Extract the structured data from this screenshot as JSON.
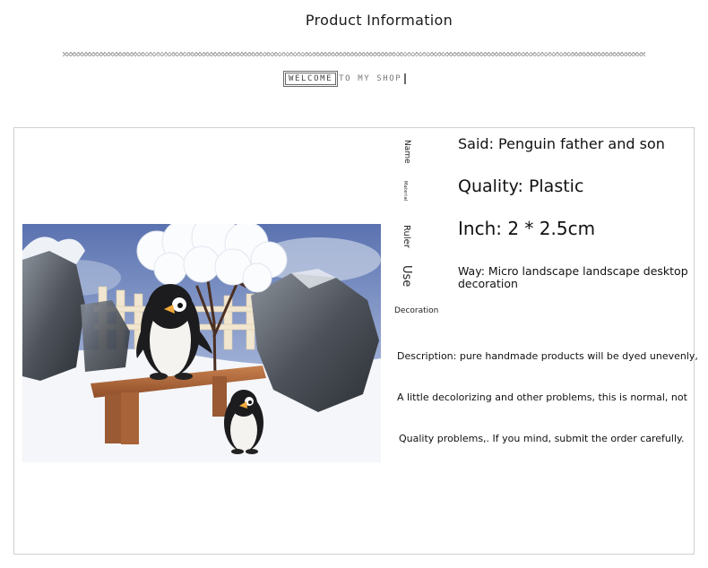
{
  "header": {
    "title": "Product Information",
    "banner_part1": "WELCOME",
    "banner_part2": "TO MY SHOP"
  },
  "specs": {
    "labels": {
      "name": "Name",
      "material": "Material",
      "ruler": "Ruler",
      "use": "Use",
      "decoration": "Decoration"
    },
    "said": "Said: Penguin father and son",
    "quality": "Quality: Plastic",
    "inch": "Inch: 2 * 2.5cm",
    "way": "Way: Micro landscape landscape desktop decoration"
  },
  "description": {
    "line1": "Description: pure handmade products will be dyed unevenly,",
    "line2": "A little decolorizing and other problems, this is normal, not",
    "line3": "Quality problems,. If you mind, submit the order carefully."
  },
  "colors": {
    "panel_border": "#cfcfcf",
    "bench": "#b5683a",
    "snow": "#f4f6f9",
    "rock": "#5b6068"
  }
}
